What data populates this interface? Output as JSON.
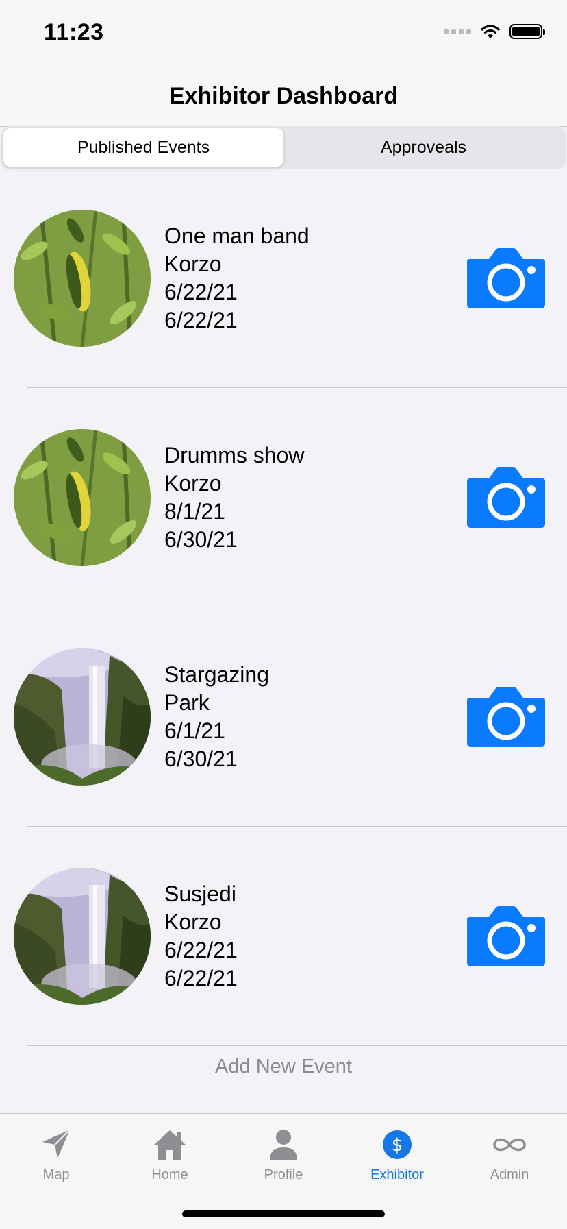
{
  "status": {
    "time": "11:23"
  },
  "nav": {
    "title": "Exhibitor Dashboard"
  },
  "segments": {
    "published": "Published Events",
    "approvals": "Approveals"
  },
  "events": [
    {
      "name": "One man band",
      "location": "Korzo",
      "date_start": "6/22/21",
      "date_end": "6/22/21",
      "image": "leaf"
    },
    {
      "name": "Drumms show",
      "location": "Korzo",
      "date_start": "8/1/21",
      "date_end": "6/30/21",
      "image": "leaf"
    },
    {
      "name": "Stargazing",
      "location": "Park",
      "date_start": "6/1/21",
      "date_end": "6/30/21",
      "image": "waterfall"
    },
    {
      "name": "Susjedi",
      "location": "Korzo",
      "date_start": "6/22/21",
      "date_end": "6/22/21",
      "image": "waterfall"
    }
  ],
  "add_event_label": "Add New Event",
  "tabs": [
    {
      "label": "Map",
      "icon": "paper-plane-icon"
    },
    {
      "label": "Home",
      "icon": "house-icon"
    },
    {
      "label": "Profile",
      "icon": "person-icon"
    },
    {
      "label": "Exhibitor",
      "icon": "dollar-circle-icon",
      "active": true
    },
    {
      "label": "Admin",
      "icon": "infinity-icon"
    }
  ],
  "colors": {
    "accent": "#0a7aff",
    "tab_active": "#1677e6",
    "tab_inactive": "#8e8e93",
    "background": "#f2f2f7"
  }
}
